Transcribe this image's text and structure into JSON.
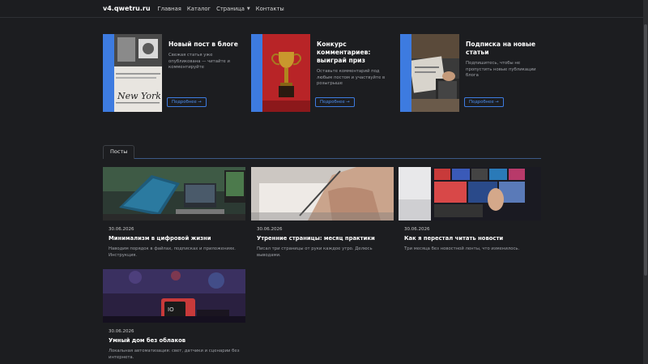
{
  "nav": {
    "brand": "v4.qwetru.ru",
    "links": [
      "Главная",
      "Каталог",
      "Страница",
      "Контакты"
    ]
  },
  "promos": [
    {
      "title": "Новый пост в блоге",
      "text": "Свежая статья уже опубликована — читайте и комментируйте",
      "button": "Подробнее →"
    },
    {
      "title": "Конкурс комментариев: выиграй приз",
      "text": "Оставьте комментарий под любым постом и участвуйте в розыгрыше",
      "button": "Подробнее →"
    },
    {
      "title": "Подписка на новые статьи",
      "text": "Подпишитесь, чтобы не пропустить новые публикации блога",
      "button": "Подробнее →"
    }
  ],
  "tabs": [
    "Посты"
  ],
  "posts": [
    {
      "date": "30.06.2026",
      "title": "Минимализм в цифровой жизни",
      "desc": "Наводим порядок в файлах, подписках и приложениях. Инструкция."
    },
    {
      "date": "30.06.2026",
      "title": "Утренние страницы: месяц практики",
      "desc": "Писал три страницы от руки каждое утро. Делюсь выводами."
    },
    {
      "date": "30.06.2026",
      "title": "Как я перестал читать новости",
      "desc": "Три месяца без новостной ленты, что изменилось."
    },
    {
      "date": "30.06.2026",
      "title": "Умный дом без облаков",
      "desc": "Локальная автоматизация: свет, датчики и сценарии без интернета."
    }
  ],
  "colors": {
    "accent": "#3d7be0",
    "background": "#1c1d20"
  }
}
